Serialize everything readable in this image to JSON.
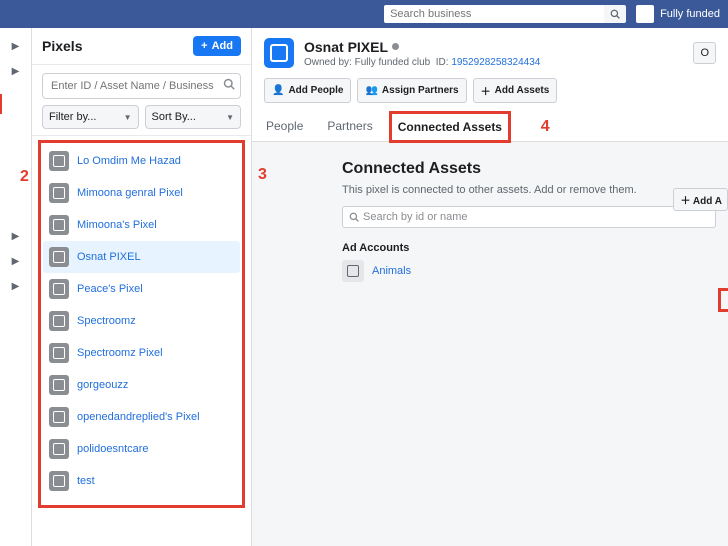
{
  "topbar": {
    "search_placeholder": "Search business",
    "account_label": "Fully funded"
  },
  "sidebar": {
    "title": "Pixels",
    "add_label": "Add",
    "search_placeholder": "Enter ID / Asset Name / Business Name",
    "filter_label": "Filter by...",
    "sort_label": "Sort By...",
    "items": [
      {
        "name": "Lo Omdim Me Hazad"
      },
      {
        "name": "Mimoona genral Pixel"
      },
      {
        "name": "Mimoona's Pixel"
      },
      {
        "name": "Osnat PIXEL"
      },
      {
        "name": "Peace's Pixel"
      },
      {
        "name": "Spectroomz"
      },
      {
        "name": "Spectroomz Pixel"
      },
      {
        "name": "gorgeouzz"
      },
      {
        "name": "openedandreplied's Pixel"
      },
      {
        "name": "polidoesntcare"
      },
      {
        "name": "test"
      }
    ],
    "selected_index": 3
  },
  "main": {
    "title": "Osnat PIXEL",
    "owned_by_prefix": "Owned by: ",
    "owned_by": "Fully funded club",
    "id_prefix": "ID: ",
    "id": "1952928258324434",
    "open_label": "O",
    "actions": {
      "add_people": "Add People",
      "assign_partners": "Assign Partners",
      "add_assets": "Add Assets"
    },
    "tabs": {
      "people": "People",
      "partners": "Partners",
      "connected": "Connected Assets"
    },
    "body": {
      "heading": "Connected Assets",
      "description": "This pixel is connected to other assets. Add or remove them.",
      "search_placeholder": "Search by id or name",
      "add_assets_label": "Add A",
      "group_label": "Ad Accounts",
      "accounts": [
        {
          "name": "Animals"
        }
      ]
    }
  },
  "annotations": {
    "n2": "2",
    "n3": "3",
    "n4": "4"
  }
}
